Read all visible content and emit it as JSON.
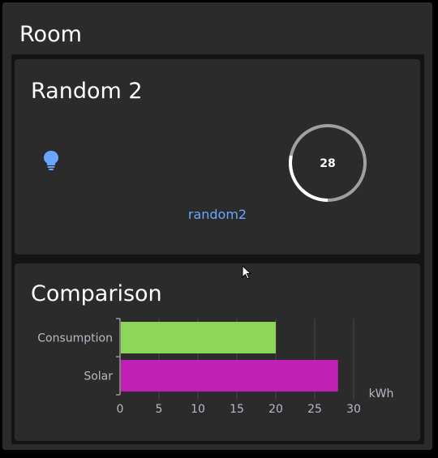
{
  "room": {
    "title": "Room"
  },
  "random_card": {
    "title": "Random 2",
    "entity_label": "random2",
    "icon": "lightbulb-icon",
    "gauge_value": "28",
    "gauge": {
      "value": 28,
      "min": 0,
      "max": 100
    },
    "colors": {
      "icon": "#6aa6ff",
      "gauge_track": "#a0a0a0",
      "gauge_fill": "#ffffff"
    }
  },
  "comparison_card": {
    "title": "Comparison"
  },
  "chart_data": {
    "type": "bar",
    "orientation": "horizontal",
    "categories": [
      "Consumption",
      "Solar"
    ],
    "values": [
      20,
      28
    ],
    "colors": [
      "#8cd65a",
      "#c020b4"
    ],
    "xlabel": "kWh",
    "xticks": [
      "0",
      "5",
      "10",
      "15",
      "20",
      "25",
      "30"
    ],
    "xlim": [
      0,
      30
    ],
    "grid": true
  }
}
